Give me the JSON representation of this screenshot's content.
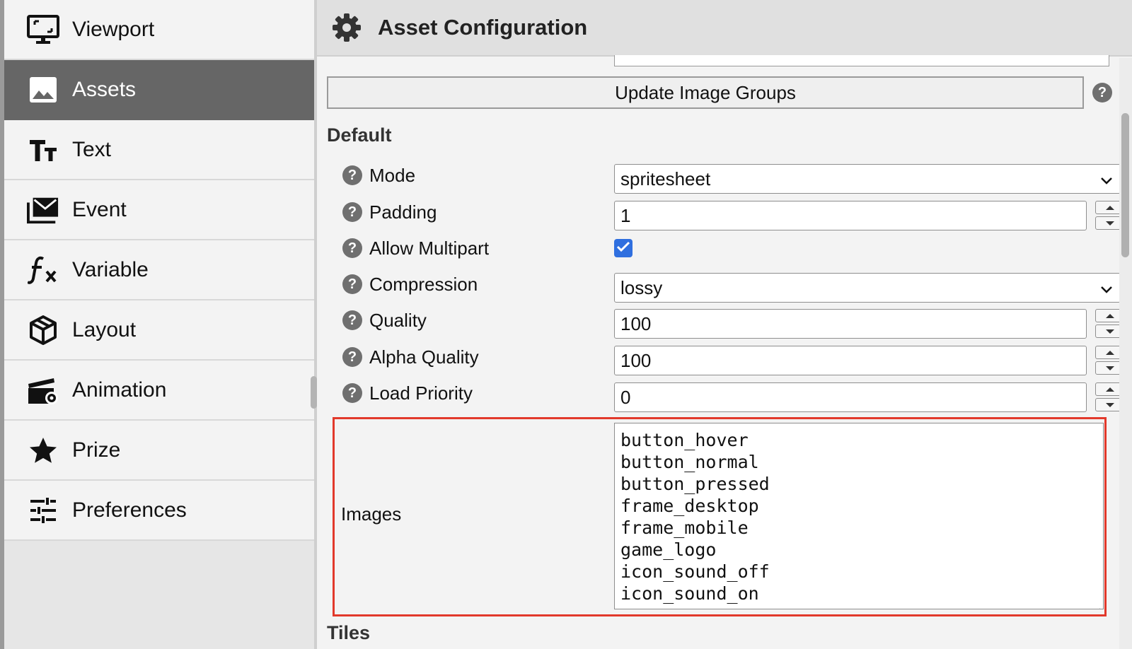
{
  "sidebar": {
    "items": [
      {
        "label": "Viewport",
        "icon": "monitor-icon",
        "active": false
      },
      {
        "label": "Assets",
        "icon": "image-icon",
        "active": true
      },
      {
        "label": "Text",
        "icon": "text-size-icon",
        "active": false
      },
      {
        "label": "Event",
        "icon": "mail-icon",
        "active": false
      },
      {
        "label": "Variable",
        "icon": "function-icon",
        "active": false
      },
      {
        "label": "Layout",
        "icon": "cube-icon",
        "active": false
      },
      {
        "label": "Animation",
        "icon": "clapperboard-gear-icon",
        "active": false
      },
      {
        "label": "Prize",
        "icon": "star-icon",
        "active": false
      },
      {
        "label": "Preferences",
        "icon": "sliders-icon",
        "active": false
      }
    ]
  },
  "header": {
    "title": "Asset Configuration",
    "icon": "gear-icon"
  },
  "update_button": {
    "label": "Update Image Groups"
  },
  "help_glyph": "?",
  "section_default": "Default",
  "fields": {
    "mode": {
      "label": "Mode",
      "value": "spritesheet"
    },
    "padding": {
      "label": "Padding",
      "value": "1"
    },
    "allow_multipart": {
      "label": "Allow Multipart",
      "checked": true
    },
    "compression": {
      "label": "Compression",
      "value": "lossy"
    },
    "quality": {
      "label": "Quality",
      "value": "100"
    },
    "alpha_quality": {
      "label": "Alpha Quality",
      "value": "100"
    },
    "load_priority": {
      "label": "Load Priority",
      "value": "0"
    }
  },
  "images": {
    "label": "Images",
    "items": [
      "button_hover",
      "button_normal",
      "button_pressed",
      "frame_desktop",
      "frame_mobile",
      "game_logo",
      "icon_sound_off",
      "icon_sound_on"
    ]
  },
  "section_tiles": "Tiles",
  "colors": {
    "highlight": "#e2392b",
    "checkbox": "#2f6fdf",
    "active_sidebar": "#666666"
  }
}
